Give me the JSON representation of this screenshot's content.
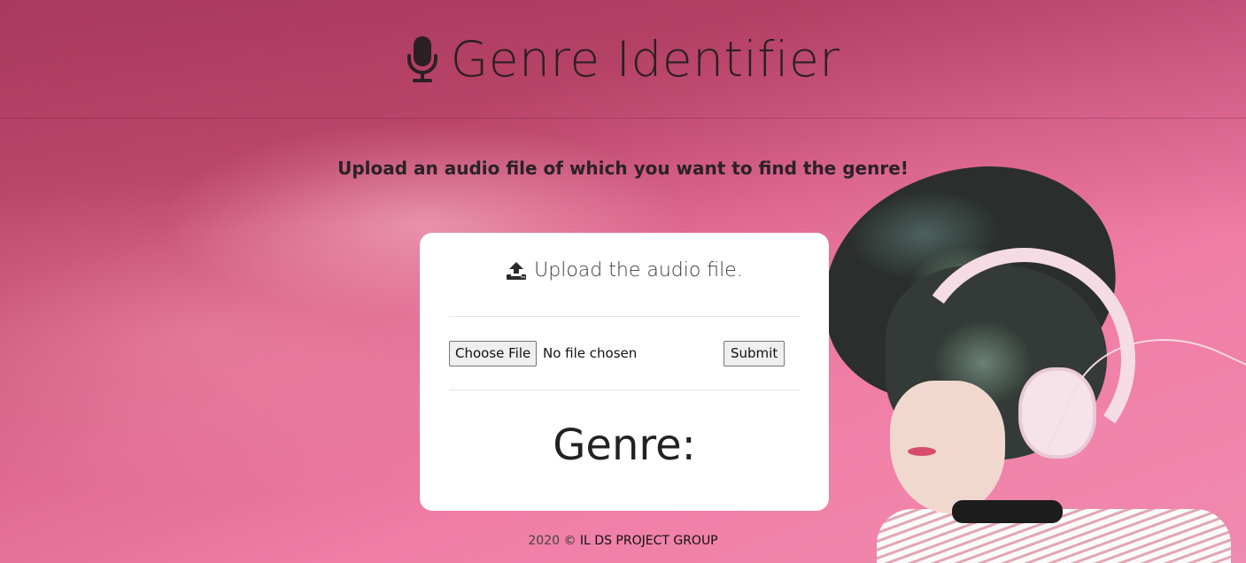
{
  "header": {
    "icon": "microphone-icon",
    "title": "Genre Identifier"
  },
  "subtitle": "Upload an audio file of which you want to find the genre!",
  "card": {
    "icon": "upload-icon",
    "title": "Upload the audio file.",
    "file_button_label": "Choose File",
    "file_status": "No file chosen",
    "submit_label": "Submit",
    "result_label": "Genre:"
  },
  "footer": {
    "year": "2020",
    "symbol": "©",
    "group": "IL DS PROJECT GROUP"
  },
  "colors": {
    "background_pink": "#f07ea5",
    "card_bg": "#ffffff",
    "text_dark": "#222222"
  }
}
